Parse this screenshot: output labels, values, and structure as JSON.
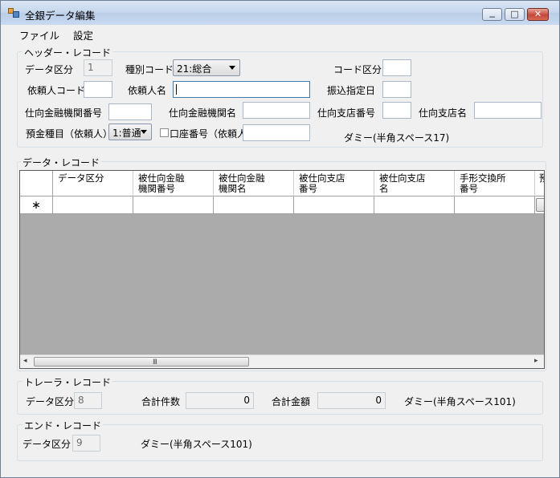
{
  "window": {
    "title": "全銀データ編集",
    "min": "0",
    "max": "1",
    "close": "r"
  },
  "menu": [
    "ファイル",
    "設定"
  ],
  "header": {
    "title": "ヘッダー・レコード",
    "data_kubun_label": "データ区分",
    "data_kubun_value": "1",
    "shubetsu_label": "種別コード",
    "shubetsu_value": "21:総合",
    "code_kubun_label": "コード区分",
    "code_kubun_value": "",
    "irai_code_label": "依頼人コード",
    "irai_code_value": "",
    "irai_name_label": "依頼人名",
    "irai_name_value": "",
    "furikomi_label": "振込指定日",
    "furikomi_value": "",
    "bank_no_label": "仕向金融機関番号",
    "bank_no_value": "",
    "bank_name_label": "仕向金融機関名",
    "bank_name_value": "",
    "branch_no_label": "仕向支店番号",
    "branch_no_value": "",
    "branch_name_label": "仕向支店名",
    "branch_name_value": "",
    "yokin_label": "預金種目（依頼人）",
    "yokin_value": "1:普通",
    "koza_label": "口座番号（依頼人）",
    "koza_value": "",
    "dummy_label": "ダミー(半角スペース17)"
  },
  "data_record": {
    "title": "データ・レコード",
    "columns": [
      "データ区分",
      "被仕向金融\n機関番号",
      "被仕向金融\n機関名",
      "被仕向支店\n番号",
      "被仕向支店\n名",
      "手形交換所\n番号",
      "預"
    ],
    "new_row_marker": "∗",
    "scroll_grip": "III",
    "scroll_left": "◂",
    "scroll_right": "▸"
  },
  "trailer": {
    "title": "トレーラ・レコード",
    "data_kubun_label": "データ区分",
    "data_kubun_value": "8",
    "count_label": "合計件数",
    "count_value": "0",
    "amount_label": "合計金額",
    "amount_value": "0",
    "dummy_label": "ダミー(半角スペース101)"
  },
  "end": {
    "title": "エンド・レコード",
    "data_kubun_label": "データ区分",
    "data_kubun_value": "9",
    "dummy_label": "ダミー(半角スペース101)"
  }
}
